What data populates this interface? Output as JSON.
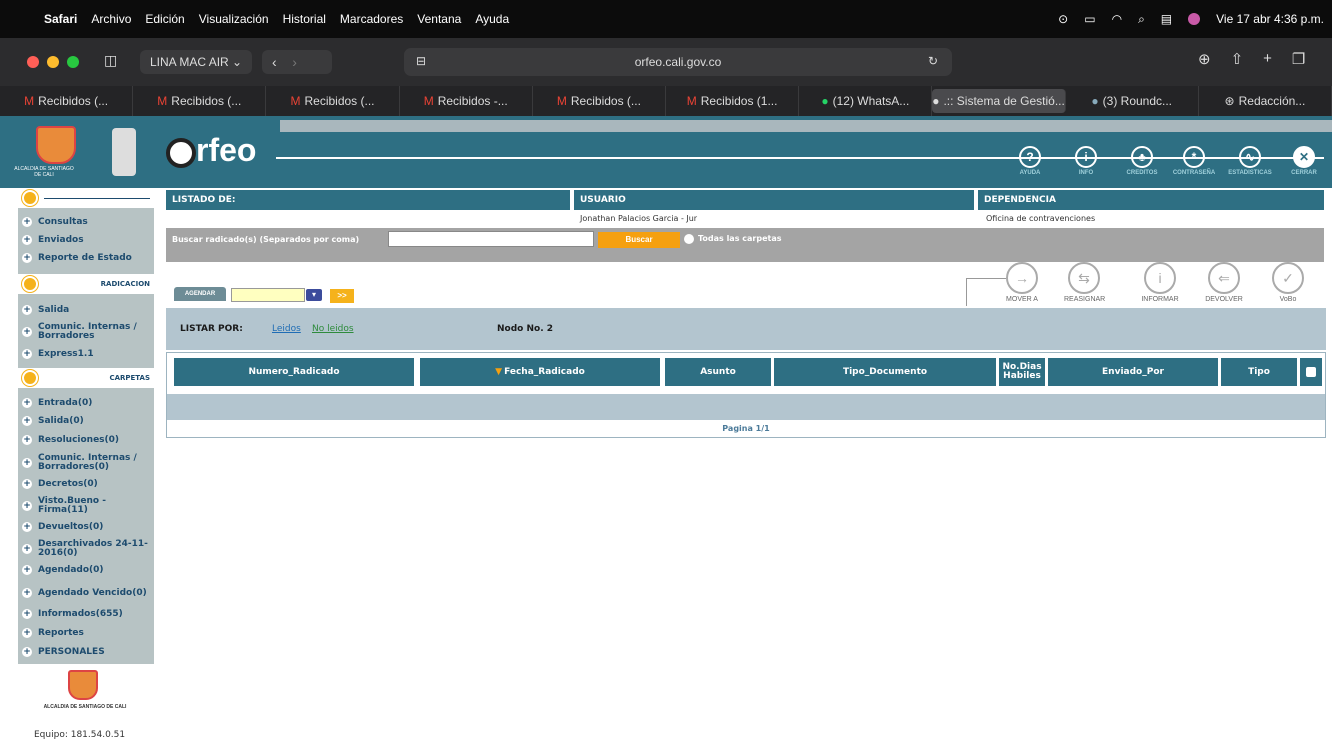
{
  "menubar": {
    "app": "Safari",
    "items": [
      "Archivo",
      "Edición",
      "Visualización",
      "Historial",
      "Marcadores",
      "Ventana",
      "Ayuda"
    ],
    "datetime": "Vie 17 abr 4:36 p.m."
  },
  "toolbar": {
    "profile": "LINA MAC AIR",
    "address": "orfeo.cali.gov.co"
  },
  "tabs": [
    "Recibidos (...",
    "Recibidos (...",
    "Recibidos (...",
    "Recibidos -...",
    "Recibidos (...",
    "Recibidos (1...",
    "(12) WhatsA...",
    ".:: Sistema de Gestió...",
    "(3) Roundc...",
    "Redacción..."
  ],
  "header": {
    "logo_text": "rfeo",
    "org": "ALCALDIA DE SANTIAGO DE CALI",
    "icons": [
      {
        "label": "AYUDA",
        "glyph": "?"
      },
      {
        "label": "INFO",
        "glyph": "i"
      },
      {
        "label": "CREDITOS",
        "glyph": "♣"
      },
      {
        "label": "CONTRASEÑA",
        "glyph": "*"
      },
      {
        "label": "ESTADISTICAS",
        "glyph": "∿"
      },
      {
        "label": "CERRAR",
        "glyph": "✕"
      }
    ]
  },
  "sidebar": {
    "top_items": [
      "Consultas",
      "Enviados",
      "Reporte de Estado"
    ],
    "radicacion_title": "RADICACION",
    "radicacion_items": [
      "Salida",
      "Comunic. Internas / Borradores",
      "Express1.1"
    ],
    "carpetas_title": "CARPETAS",
    "carpetas_items": [
      "Entrada(0)",
      "Salida(0)",
      "Resoluciones(0)",
      "Comunic. Internas / Borradores(0)",
      "Decretos(0)",
      "Visto.Bueno - Firma(11)",
      "Devueltos(0)",
      "Desarchivados 24-11-2016(0)",
      "Agendado(0)",
      "Agendado Vencido(0)",
      "Informados(655)",
      "Reportes",
      "PERSONALES"
    ],
    "footer_org": "ALCALDIA DE SANTIAGO DE CALI",
    "equipo": "Equipo: 181.54.0.51"
  },
  "info": {
    "listado_label": "LISTADO DE:",
    "usuario_label": "USUARIO",
    "usuario_value": "Jonathan Palacios Garcia - Jur",
    "dependencia_label": "DEPENDENCIA",
    "dependencia_value": "Oficina de contravenciones"
  },
  "search": {
    "label": "Buscar radicado(s) (Separados por coma)",
    "value": "",
    "button": "Buscar",
    "checkbox_label": "Todas las carpetas"
  },
  "agendar": {
    "button": "AGENDAR",
    "go": ">>"
  },
  "actions": [
    "MOVER A",
    "REASIGNAR",
    "INFORMAR",
    "DEVOLVER",
    "VoBo"
  ],
  "listar": {
    "label": "LISTAR POR:",
    "leidos": "Leidos",
    "no_leidos": "No leidos",
    "nodo": "Nodo No. 2"
  },
  "table": {
    "columns": [
      "Numero_Radicado",
      "Fecha_Radicado",
      "Asunto",
      "Tipo_Documento",
      "No.Dias Habiles",
      "Enviado_Por",
      "Tipo"
    ],
    "pagination": "Pagina 1/1"
  }
}
